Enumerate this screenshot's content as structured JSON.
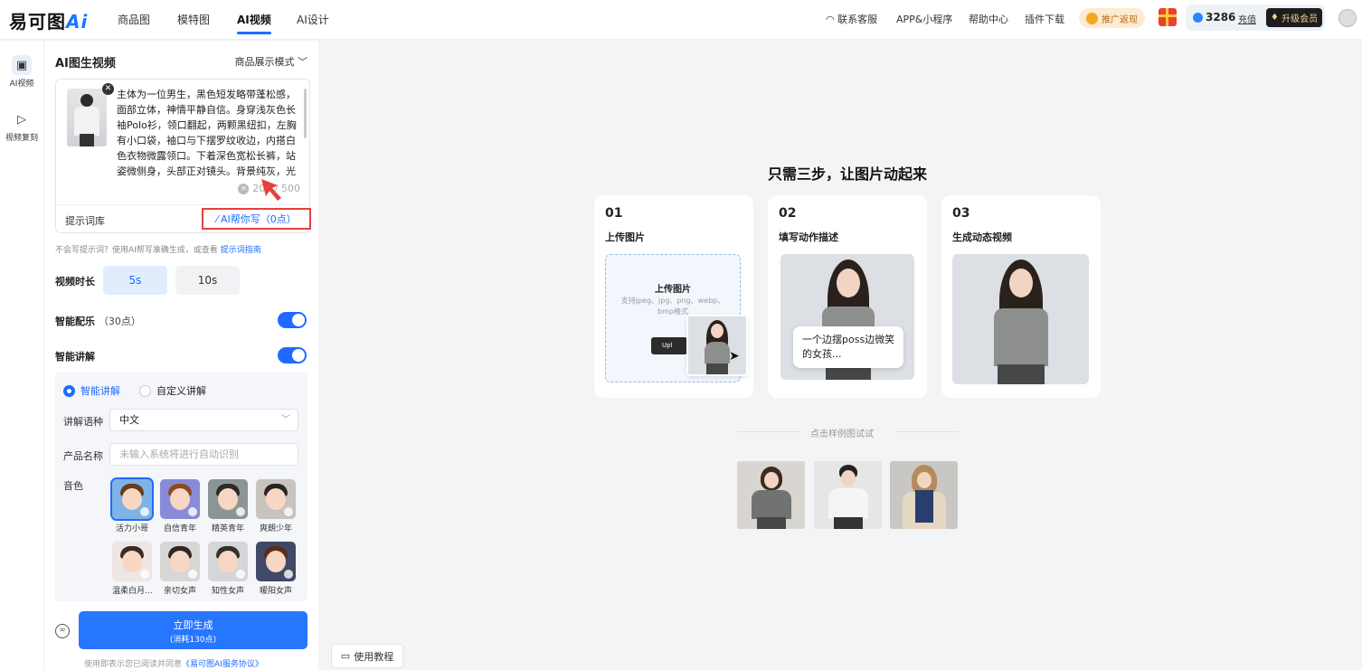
{
  "brand": {
    "logo_text": "易可图",
    "logo_ai": "Ai"
  },
  "nav": {
    "tabs": [
      {
        "label": "商品图"
      },
      {
        "label": "模特图"
      },
      {
        "label": "AI视频"
      },
      {
        "label": "AI设计"
      }
    ],
    "active_tab": "AI视频",
    "right_links": [
      {
        "label": "联系客服"
      },
      {
        "label": "APP&小程序"
      },
      {
        "label": "帮助中心"
      },
      {
        "label": "插件下载"
      }
    ],
    "promo_label": "推广返现",
    "points": "3286",
    "recharge_label": "充值",
    "upgrade_label": "升级会员"
  },
  "rail": {
    "items": [
      {
        "label": "AI视频",
        "icon": "image-video-icon"
      },
      {
        "label": "视频复刻",
        "icon": "video-copy-icon"
      }
    ]
  },
  "panel": {
    "title": "AI图生视频",
    "mode_label": "商品展示模式",
    "prompt_text": "主体为一位男生，黑色短发略带蓬松感，面部立体，神情平静自信。身穿浅灰色长袖Polo衫，领口翻起，两颗黑纽扣，左胸有小口袋，袖口与下摆罗纹收边，内搭白色衣物微露领口。下着深色宽松长裤，站姿微侧身，头部正对镜头。背景纯灰，光",
    "char_count": "200 / 500",
    "prompt_library_label": "提示词库",
    "ai_write_label": "AI帮你写（0点）",
    "hint_text": "不会写提示词？使用AI帮写准确生成，或查看",
    "hint_link": "提示词指南",
    "duration_label": "视频时长",
    "durations": [
      "5s",
      "10s"
    ],
    "selected_duration": "5s",
    "music_label": "智能配乐",
    "music_cost": "（30点）",
    "music_on": true,
    "narration_label": "智能讲解",
    "narration_on": true,
    "narration": {
      "options": [
        "智能讲解",
        "自定义讲解"
      ],
      "selected": "智能讲解",
      "language_label": "讲解语种",
      "language_value": "中文",
      "product_label": "产品名称",
      "product_placeholder": "未输入系统将进行自动识别",
      "voice_label": "音色",
      "voices": [
        {
          "name": "活力小哥",
          "selected": true
        },
        {
          "name": "自信青年",
          "selected": false
        },
        {
          "name": "精英青年",
          "selected": false
        },
        {
          "name": "爽朗少年",
          "selected": false
        },
        {
          "name": "温柔白月...",
          "selected": false
        },
        {
          "name": "亲切女声",
          "selected": false
        },
        {
          "name": "知性女声",
          "selected": false
        },
        {
          "name": "暖阳女声",
          "selected": false
        }
      ]
    },
    "generate_label": "立即生成",
    "generate_cost": "(消耗130点)",
    "terms_prefix": "使用即表示您已阅读并同意",
    "terms_link": "《易可图AI服务协议》"
  },
  "main": {
    "title": "只需三步，让图片动起来",
    "steps": [
      {
        "num": "01",
        "label": "上传图片"
      },
      {
        "num": "02",
        "label": "填写动作描述"
      },
      {
        "num": "03",
        "label": "生成动态视频"
      }
    ],
    "upload_title": "上传图片",
    "upload_formats": "支持jpeg、jpg、png、webp、bmp格式",
    "upload_button": "Upl",
    "bubble_text": "一个边摆poss边微笑的女孩...",
    "try_label": "点击样例图试试",
    "tutorial_label": "使用教程"
  }
}
